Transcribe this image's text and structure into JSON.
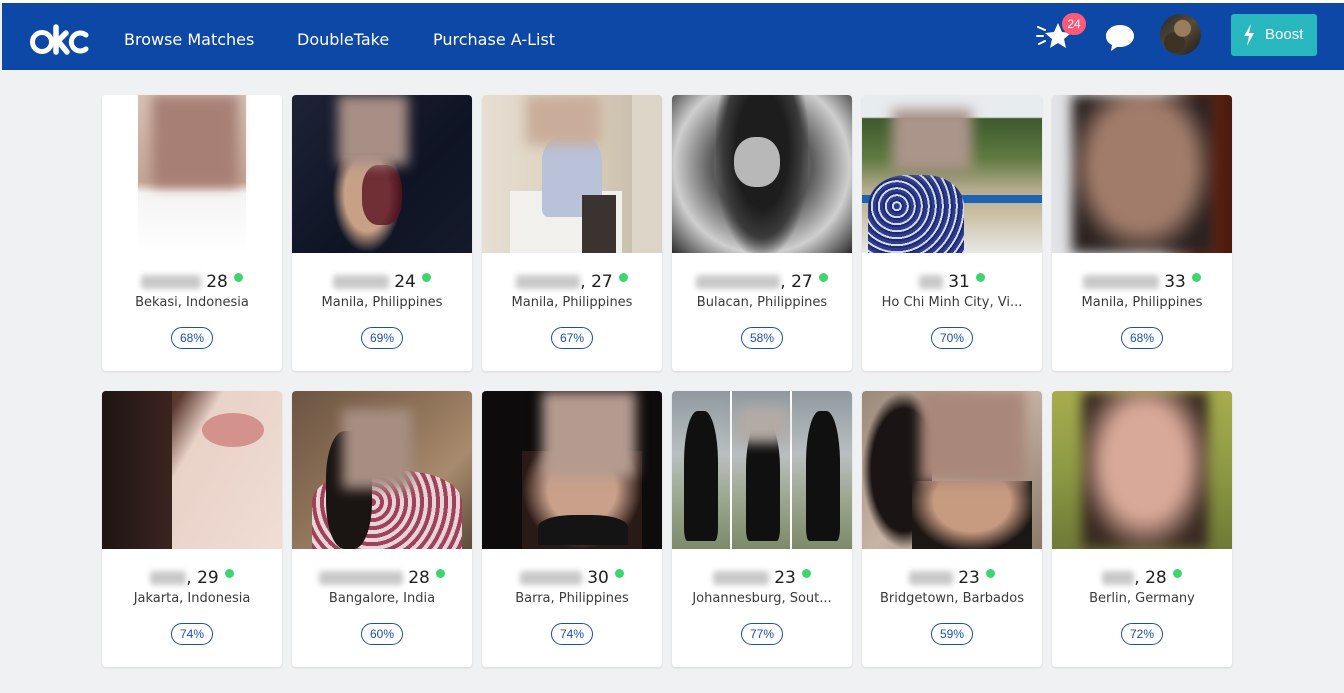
{
  "header": {
    "brand": "okc",
    "nav": [
      "Browse Matches",
      "DoubleTake",
      "Purchase A-List"
    ],
    "notification_count": "24",
    "boost_label": "Boost",
    "icons": [
      "star-icon",
      "chat-bubble-icon",
      "bolt-icon"
    ],
    "colors": {
      "navbar": "#0e48a6",
      "boost": "#28b7bf",
      "badge": "#ff5a7a",
      "online": "#3dd66c",
      "match": "#1b4fb0"
    }
  },
  "profiles": [
    {
      "age": "28",
      "location": "Bekasi, Indonesia",
      "match": "68%"
    },
    {
      "age": "24",
      "location": "Manila, Philippines",
      "match": "69%"
    },
    {
      "age": ", 27",
      "location": "Manila, Philippines",
      "match": "67%"
    },
    {
      "age": ", 27",
      "location": "Bulacan, Philippines",
      "match": "58%"
    },
    {
      "age": "31",
      "location": "Ho Chi Minh City, Vi...",
      "match": "70%"
    },
    {
      "age": "33",
      "location": "Manila, Philippines",
      "match": "68%"
    },
    {
      "age": ", 29",
      "location": "Jakarta, Indonesia",
      "match": "74%"
    },
    {
      "age": "28",
      "location": "Bangalore, India",
      "match": "60%"
    },
    {
      "age": "30",
      "location": "Barra, Philippines",
      "match": "74%"
    },
    {
      "age": "23",
      "location": "Johannesburg, Sout...",
      "match": "77%"
    },
    {
      "age": "23",
      "location": "Bridgetown, Barbados",
      "match": "59%"
    },
    {
      "age": ", 28",
      "location": "Berlin, Germany",
      "match": "72%"
    }
  ]
}
